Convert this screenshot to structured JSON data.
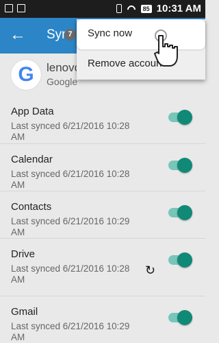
{
  "status_bar": {
    "time": "10:31",
    "time_suffix": "AM",
    "battery": "85"
  },
  "app_bar": {
    "title": "Sync",
    "back_icon": "back-arrow-icon",
    "badge": "7"
  },
  "account": {
    "name": "lenovo",
    "type": "Google"
  },
  "sync_items": [
    {
      "title": "App Data",
      "subtitle": "Last synced 6/21/2016 10:28 AM",
      "enabled": true
    },
    {
      "title": "Calendar",
      "subtitle": "Last synced 6/21/2016 10:28 AM",
      "enabled": true
    },
    {
      "title": "Contacts",
      "subtitle": "Last synced 6/21/2016 10:29 AM",
      "enabled": true
    },
    {
      "title": "Drive",
      "subtitle": "Last synced 6/21/2016 10:28 AM",
      "enabled": true,
      "syncing_icon": "sync-icon"
    },
    {
      "title": "Gmail",
      "subtitle": "Last synced 6/21/2016 10:29 AM",
      "enabled": true
    }
  ],
  "menu": {
    "items": [
      "Sync now",
      "Remove account"
    ]
  },
  "colors": {
    "app_bar": "#2b85c6",
    "toggle_on": "#108977",
    "toggle_track": "#78c5b9"
  }
}
